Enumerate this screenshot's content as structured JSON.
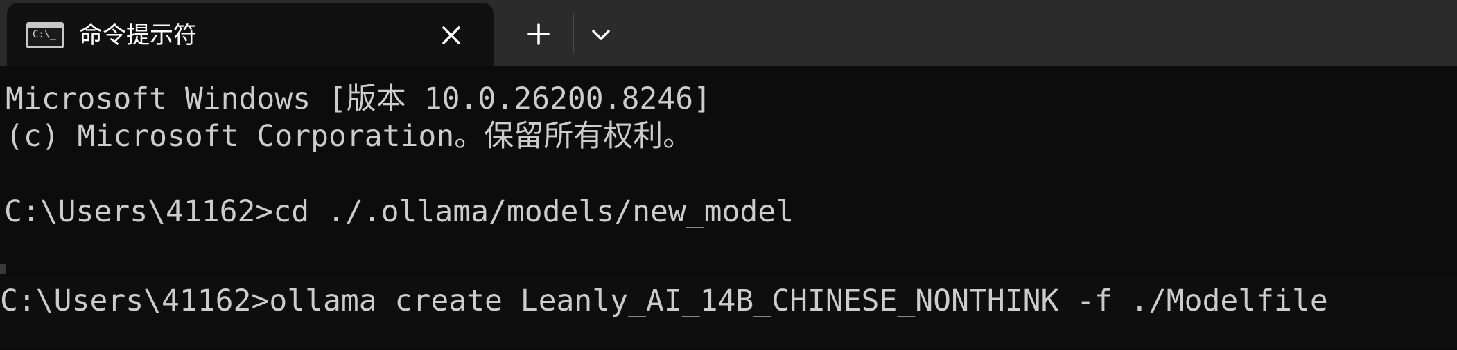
{
  "window": {
    "tab_title": "命令提示符",
    "tab_icon": "command-prompt-icon",
    "tab_icon_text": "C:\\_",
    "close_icon": "close-icon",
    "new_tab_icon": "plus-icon",
    "dropdown_icon": "chevron-down-icon"
  },
  "terminal": {
    "lines": [
      "Microsoft Windows [版本 10.0.26200.8246]",
      "(c) Microsoft Corporation。保留所有权利。",
      "",
      "C:\\Users\\41162>cd ./.ollama/models/new_model",
      "",
      "C:\\Users\\41162>ollama create Leanly_AI_14B_CHINESE_NONTHINK -f ./Modelfile"
    ]
  },
  "colors": {
    "titlebar_bg": "#2b2b2b",
    "tab_bg": "#111111",
    "terminal_bg": "#0c0c0c",
    "terminal_text": "#cccccc"
  }
}
